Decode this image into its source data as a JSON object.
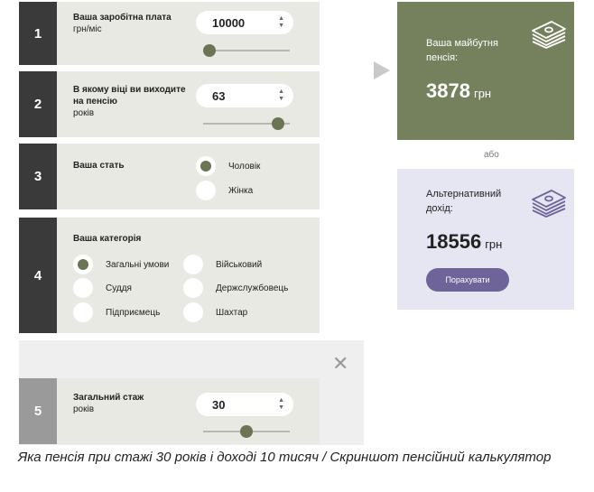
{
  "steps": {
    "s1": {
      "num": "1",
      "label_line1": "Ваша заробітна плата",
      "label_line2": "грн/міс",
      "value": "10000",
      "slider_level": 0.05
    },
    "s2": {
      "num": "2",
      "label_line1": "В якому віці ви виходите",
      "label_line2": "на пенсію",
      "label_line3": "років",
      "value": "63",
      "slider_level": 0.85
    },
    "s3": {
      "num": "3",
      "label": "Ваша стать",
      "options": [
        "Чоловік",
        "Жінка"
      ],
      "selected": "Чоловік"
    },
    "s4": {
      "num": "4",
      "label": "Ваша категорія",
      "options": [
        "Загальні умови",
        "Військовий",
        "Суддя",
        "Держслужбовець",
        "Підприємець",
        "Шахтар"
      ],
      "selected": "Загальні умови"
    },
    "s5": {
      "num": "5",
      "label_line1": "Загальний стаж",
      "label_line2": "років",
      "value": "30",
      "slider_level": 0.45
    }
  },
  "result_main": {
    "title_line1": "Ваша майбутня",
    "title_line2": "пенсія:",
    "value": "3878",
    "unit": "грн",
    "bg_color": "#75805d"
  },
  "or_text": "або",
  "result_alt": {
    "title_line1": "Альтернативний",
    "title_line2": "дохід:",
    "value": "18556",
    "unit": "грн",
    "button_label": "Порахувати",
    "button_color": "#6f6499"
  },
  "close_icon": "close-icon",
  "caption": "Яка пенсія при стажі 30 років і доході 10 тисяч / Скриншот пенсійний калькулятор"
}
